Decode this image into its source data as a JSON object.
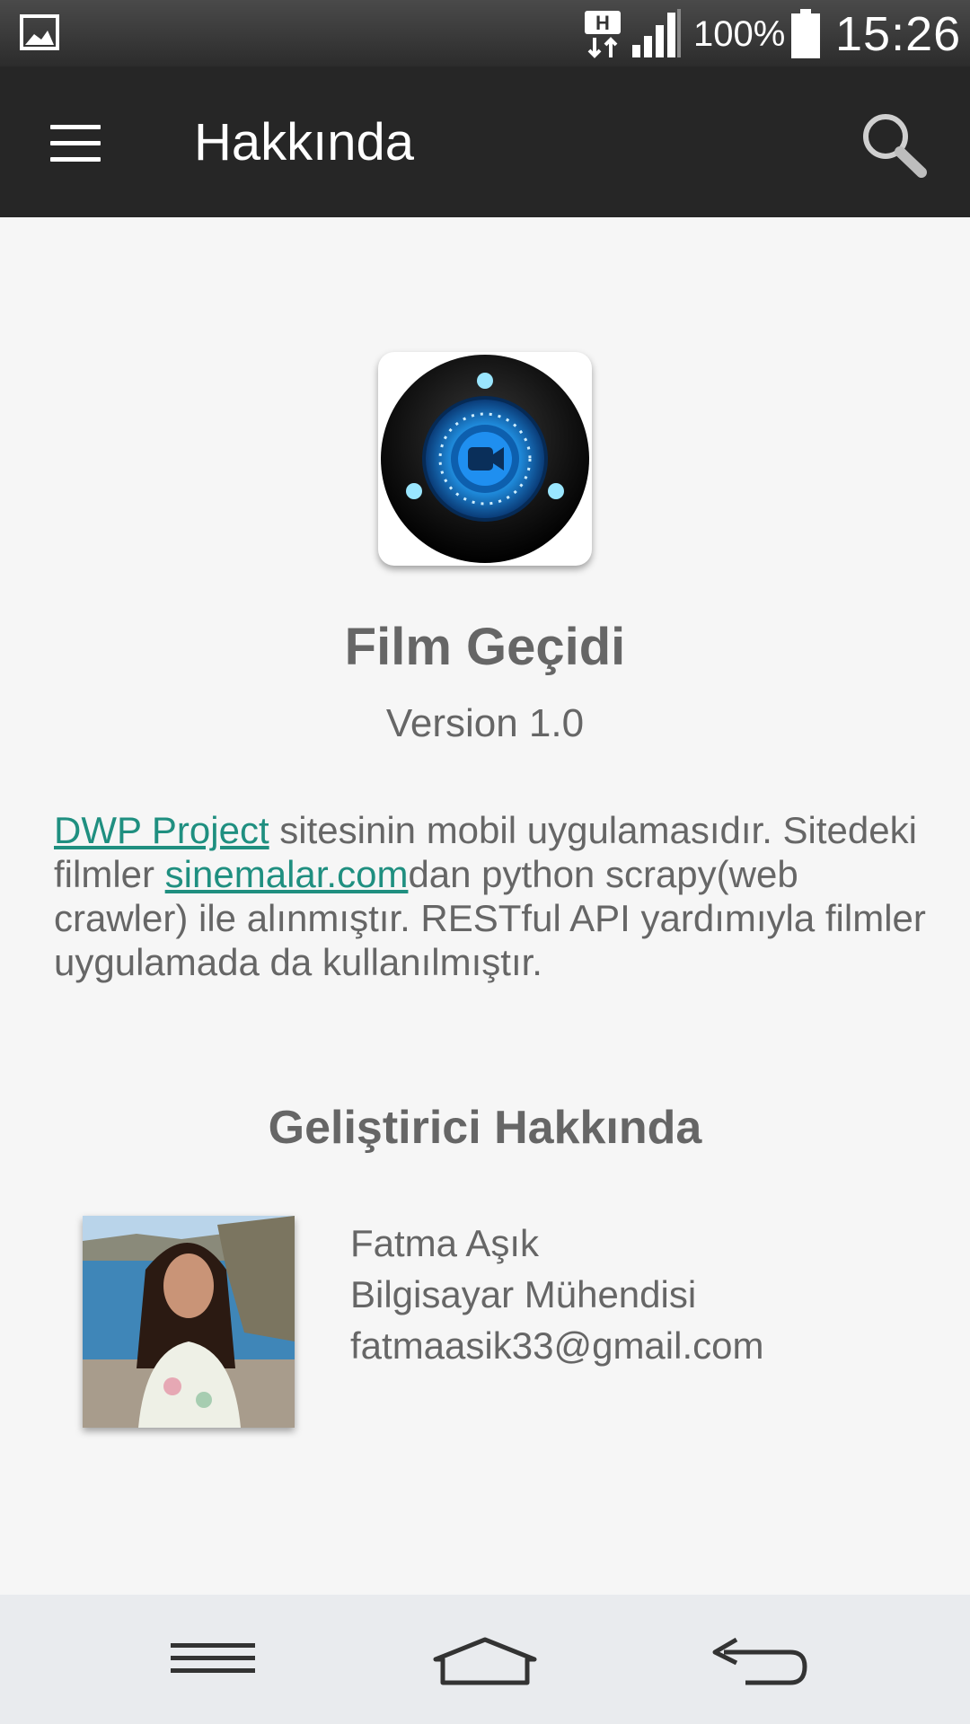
{
  "status_bar": {
    "network_type": "H",
    "battery_percent": "100%",
    "time": "15:26",
    "icons": [
      "gallery-icon",
      "network-h-icon",
      "signal-icon",
      "battery-icon"
    ]
  },
  "toolbar": {
    "title": "Hakkında",
    "icons": [
      "hamburger-menu-icon",
      "search-icon"
    ]
  },
  "app": {
    "name": "Film Geçidi",
    "version": "Version 1.0"
  },
  "description": {
    "link1": "DWP Project",
    "text1": " sitesinin mobil uygulamasıdır. Sitedeki filmler ",
    "link2": "sinemalar.com",
    "text2": "dan python scrapy(web crawler) ile alınmıştır. RESTful API yardımıyla filmler uygulamada da kullanılmıştır."
  },
  "developer": {
    "heading": "Geliştirici Hakkında",
    "name": "Fatma Aşık",
    "title": "Bilgisayar Mühendisi",
    "email": "fatmaasik33@gmail.com"
  },
  "colors": {
    "toolbar_bg": "#262626",
    "page_bg": "#f6f6f6",
    "link": "#1f8f80",
    "text": "#666666",
    "nav_bar_bg": "#e9ebee"
  },
  "nav_bar": {
    "icons": [
      "recent-apps-icon",
      "home-icon",
      "back-icon"
    ]
  }
}
